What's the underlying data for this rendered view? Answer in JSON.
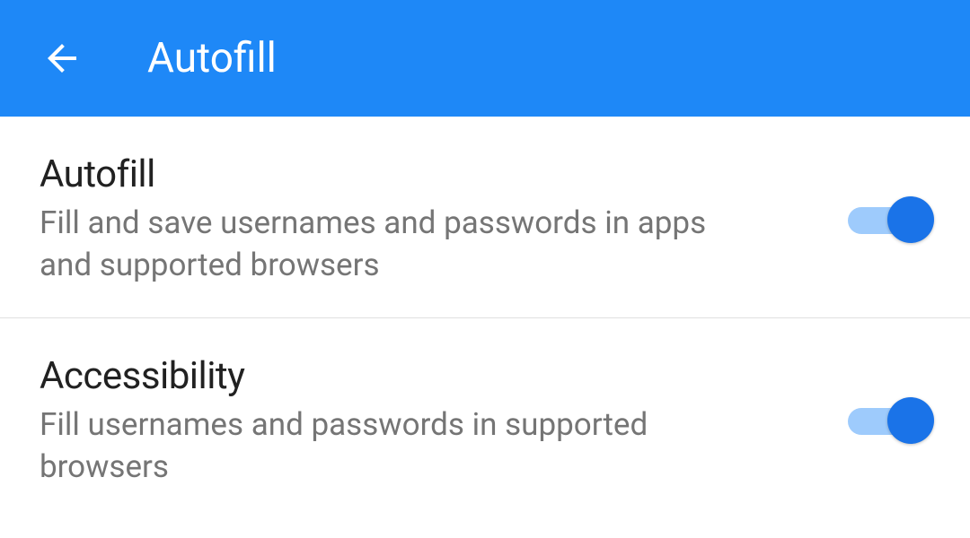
{
  "header": {
    "title": "Autofill"
  },
  "settings": [
    {
      "title": "Autofill",
      "description": "Fill and save usernames and passwords in apps and supported browsers",
      "enabled": true
    },
    {
      "title": "Accessibility",
      "description": "Fill usernames and passwords in supported browsers",
      "enabled": true
    }
  ],
  "colors": {
    "primary": "#1e88f7",
    "toggleThumb": "#1a73e8",
    "toggleTrack": "#9ecbfc"
  }
}
